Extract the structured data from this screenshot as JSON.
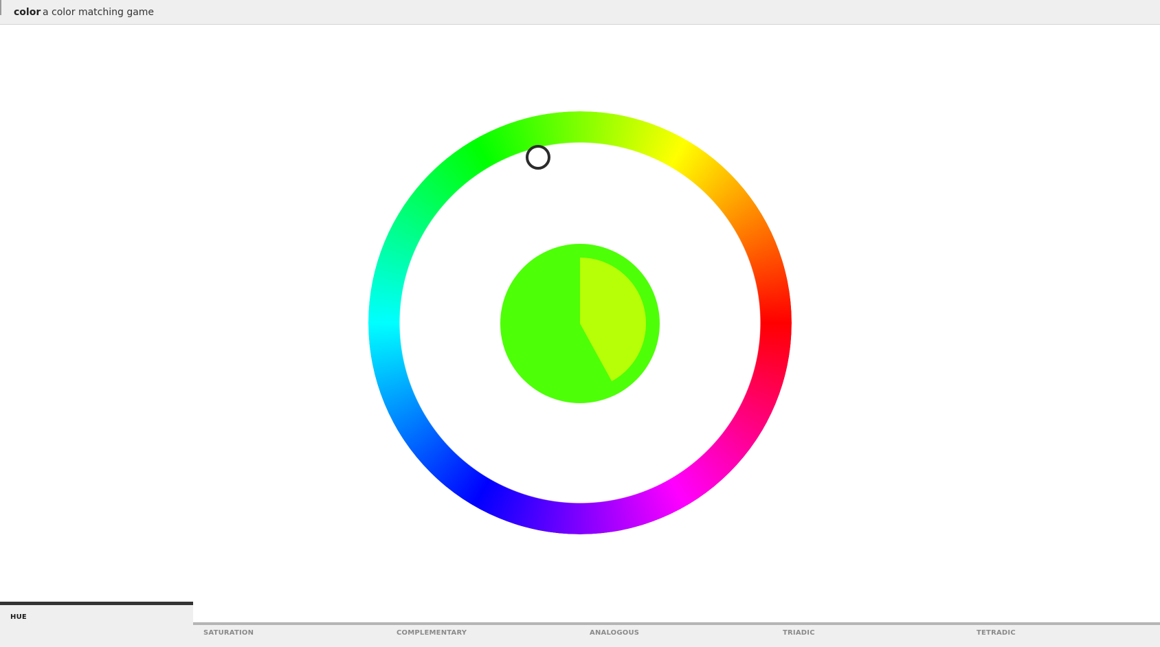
{
  "header": {
    "app_name": "color",
    "tagline": "a color matching game"
  },
  "game": {
    "mode": "hue",
    "target_color": "#4dff07",
    "guess_color": "#b6ff07",
    "progress_fraction": 0.42,
    "ring_colors": [
      "#ff0000",
      "#ff00ff",
      "#0000ff",
      "#00ffff",
      "#00ff00",
      "#ffff00"
    ]
  },
  "tabs": [
    {
      "id": "hue",
      "label": "HUE",
      "active": true
    },
    {
      "id": "saturation",
      "label": "SATURATION",
      "active": false
    },
    {
      "id": "complementary",
      "label": "COMPLEMENTARY",
      "active": false
    },
    {
      "id": "analogous",
      "label": "ANALOGOUS",
      "active": false
    },
    {
      "id": "triadic",
      "label": "TRIADIC",
      "active": false
    },
    {
      "id": "tetradic",
      "label": "TETRADIC",
      "active": false
    }
  ]
}
